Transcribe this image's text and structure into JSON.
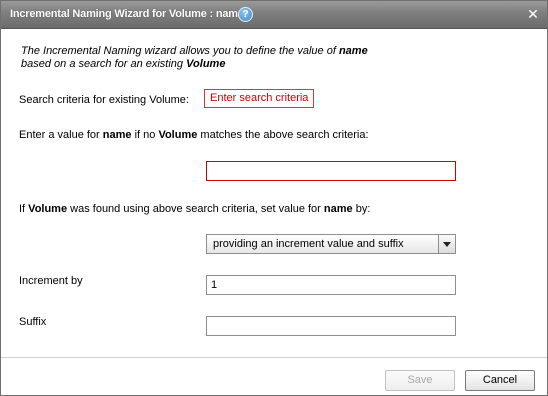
{
  "dialog": {
    "title": "Incremental Naming Wizard for Volume : name",
    "help_icon": "question-mark-icon",
    "close_icon": "close-x-icon"
  },
  "intro": {
    "part1": "The Incremental Naming wizard allows you to define the value of ",
    "field_name": "name",
    "part2": "based on a search for an existing ",
    "object_name": "Volume"
  },
  "search_criteria": {
    "label": "Search criteria for existing Volume:",
    "link_text": "Enter search criteria"
  },
  "fallback": {
    "label_part1": "Enter a value for ",
    "label_field": "name",
    "label_part2": " if no ",
    "label_object": "Volume",
    "label_part3": " matches the above search criteria:",
    "value": ""
  },
  "found": {
    "label_part1": "If ",
    "label_object": "Volume",
    "label_part2": " was found using above search criteria, set value for ",
    "label_field": "name",
    "label_part3": " by:",
    "selected_option": "providing an increment value and suffix"
  },
  "increment": {
    "label": "Increment by",
    "value": "1"
  },
  "suffix": {
    "label": "Suffix",
    "value": ""
  },
  "footer": {
    "save_label": "Save",
    "cancel_label": "Cancel"
  },
  "colors": {
    "title_bar": "#7e7e7e",
    "required_border": "#d00000",
    "link_text": "#d00000"
  }
}
